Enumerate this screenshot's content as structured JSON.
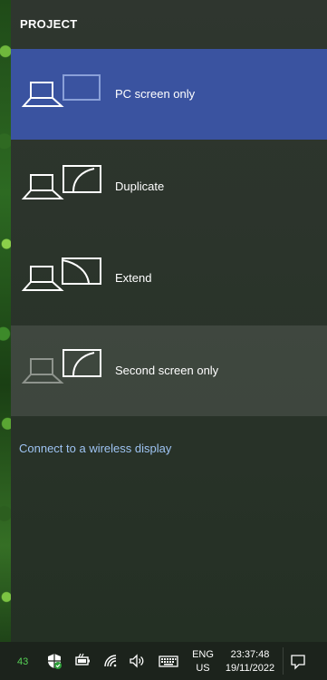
{
  "panel": {
    "title": "PROJECT",
    "options": [
      {
        "label": "PC screen only",
        "icon": "pc-screen-only-icon",
        "state": "selected"
      },
      {
        "label": "Duplicate",
        "icon": "duplicate-icon",
        "state": "normal"
      },
      {
        "label": "Extend",
        "icon": "extend-icon",
        "state": "normal"
      },
      {
        "label": "Second screen only",
        "icon": "second-screen-only-icon",
        "state": "hovered"
      }
    ],
    "wireless_link": "Connect to a wireless display"
  },
  "taskbar": {
    "notification_count": "43",
    "language_line1": "ENG",
    "language_line2": "US",
    "time": "23:37:48",
    "date": "19/11/2022",
    "icons": [
      "security-shield-icon",
      "battery-icon",
      "wifi-icon",
      "volume-icon",
      "keyboard-icon",
      "action-center-icon"
    ]
  },
  "colors": {
    "selected": "#3a53a0",
    "panel_background": "#2b342b",
    "link": "#9ec3f2",
    "count": "#56d156"
  }
}
